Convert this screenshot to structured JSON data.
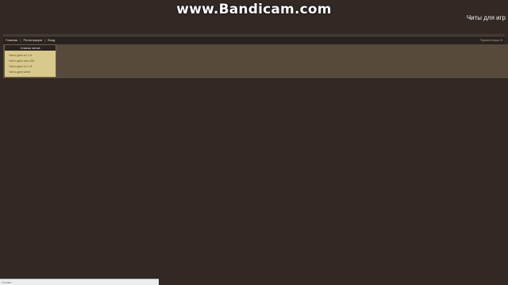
{
  "overlay": {
    "watermark": "www.Bandicam.com"
  },
  "header": {
    "site_title": "Читы для игр"
  },
  "nav": {
    "links": [
      "Главная",
      "Регистрация",
      "Вход"
    ],
    "separator": "|",
    "welcome_text": "Приветствую В"
  },
  "menu": {
    "title": "Список читов",
    "items": [
      "Читы для cs 1.6",
      "Читы для css v34",
      "Читы для cs 1.6",
      "Читы для war3"
    ]
  },
  "status_bar": {
    "text": "Готово"
  },
  "colors": {
    "background": "#322925",
    "band": "#574a3c",
    "menu_bg": "#d9c98d",
    "menu_header": "#2b2320",
    "text_light": "#f2f2f2"
  }
}
